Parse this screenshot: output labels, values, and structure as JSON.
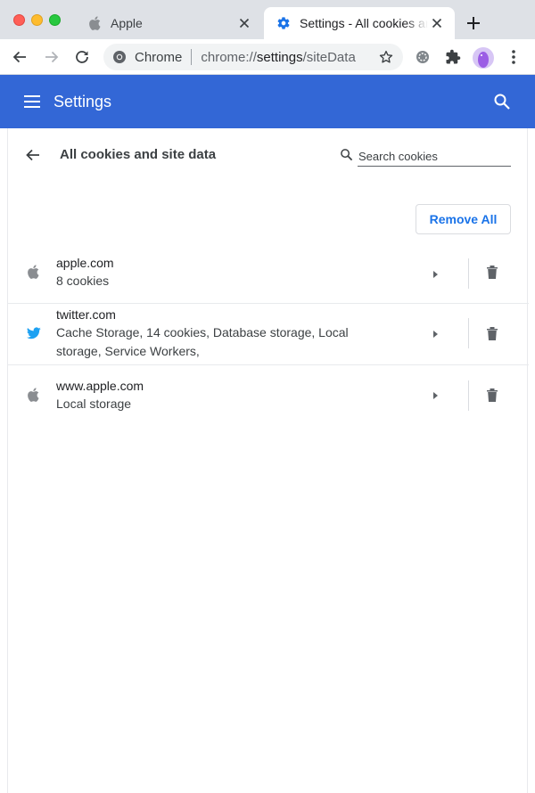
{
  "tabs": [
    {
      "title": "Apple",
      "favicon": "apple-icon",
      "active": false
    },
    {
      "title": "Settings - All cookies and site data",
      "favicon": "gear-icon",
      "active": true
    }
  ],
  "toolbar": {
    "omnibox_scheme": "Chrome",
    "url_prefix": "chrome://",
    "url_bold": "settings",
    "url_suffix": "/siteData"
  },
  "settings": {
    "title": "Settings"
  },
  "page": {
    "title": "All cookies and site data",
    "search_placeholder": "Search cookies",
    "remove_all_label": "Remove All"
  },
  "sites": [
    {
      "name": "apple.com",
      "detail": "8 cookies",
      "icon": "apple-icon"
    },
    {
      "name": "twitter.com",
      "detail": "Cache Storage, 14 cookies, Database storage, Local storage, Service Workers,",
      "icon": "twitter-bird-icon"
    },
    {
      "name": "www.apple.com",
      "detail": "Local storage",
      "icon": "apple-icon"
    }
  ],
  "colors": {
    "header_blue": "#3367d6",
    "link_blue": "#1a73e8",
    "twitter_blue": "#1da1f2"
  }
}
